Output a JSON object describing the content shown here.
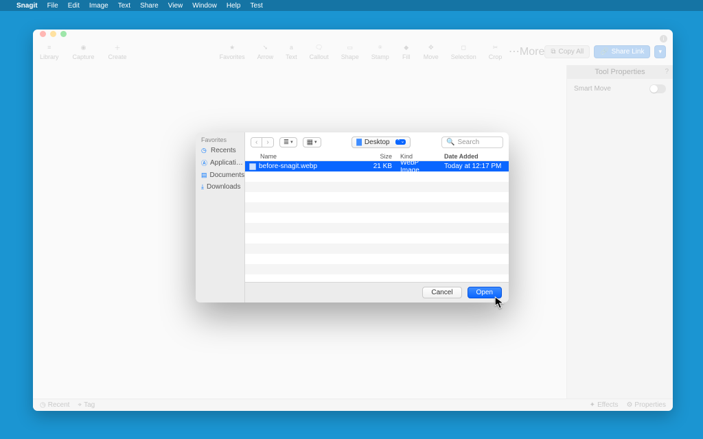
{
  "menubar": {
    "app": "Snagit",
    "items": [
      "File",
      "Edit",
      "Image",
      "Text",
      "Share",
      "View",
      "Window",
      "Help",
      "Test"
    ]
  },
  "toolbar": {
    "left": [
      {
        "label": "Library"
      },
      {
        "label": "Capture"
      },
      {
        "label": "Create"
      }
    ],
    "center": [
      {
        "label": "Favorites"
      },
      {
        "label": "Arrow"
      },
      {
        "label": "Text"
      },
      {
        "label": "Callout"
      },
      {
        "label": "Shape"
      },
      {
        "label": "Stamp"
      },
      {
        "label": "Fill"
      },
      {
        "label": "Move"
      },
      {
        "label": "Selection"
      },
      {
        "label": "Crop"
      }
    ],
    "more": "More",
    "copyall": "Copy All",
    "sharelink": "Share Link"
  },
  "sidepanel": {
    "title": "Tool Properties",
    "prop1": "Smart Move"
  },
  "footer": {
    "recent": "Recent",
    "tag": "Tag",
    "effects": "Effects",
    "properties": "Properties"
  },
  "dialog": {
    "sidebar_header": "Favorites",
    "sidebar_items": [
      {
        "label": "Recents",
        "icon": "clock"
      },
      {
        "label": "Applicati…",
        "icon": "app"
      },
      {
        "label": "Documents",
        "icon": "doc"
      },
      {
        "label": "Downloads",
        "icon": "down"
      }
    ],
    "location": "Desktop",
    "search_placeholder": "Search",
    "cols": {
      "name": "Name",
      "size": "Size",
      "kind": "Kind",
      "date": "Date Added"
    },
    "files": [
      {
        "name": "before-snagit.webp",
        "size": "21 KB",
        "kind": "WebP Image",
        "date": "Today at 12:17 PM",
        "selected": true
      }
    ],
    "cancel": "Cancel",
    "open": "Open"
  }
}
